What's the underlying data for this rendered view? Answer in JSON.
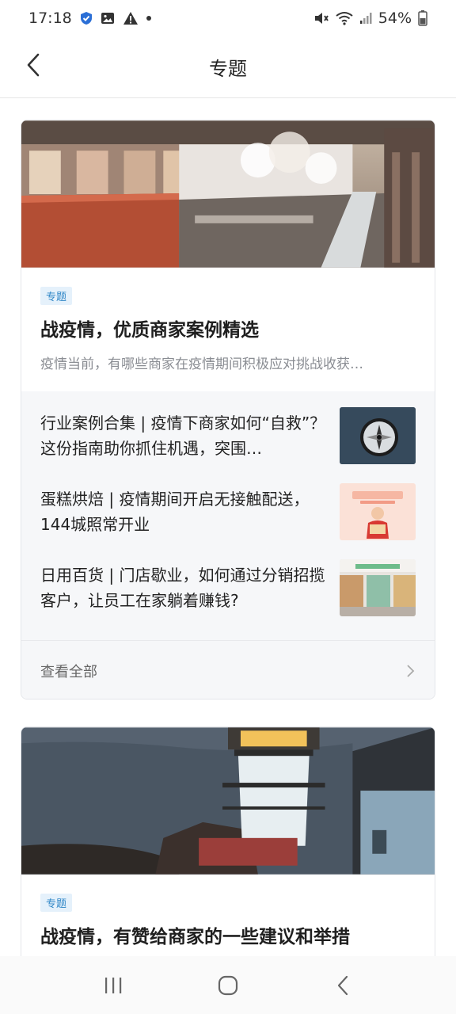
{
  "status_bar": {
    "time": "17:18",
    "battery": "54%"
  },
  "header": {
    "title": "专题"
  },
  "cards": [
    {
      "tag": "专题",
      "title": "战疫情，优质商家案例精选",
      "description": "疫情当前，有哪些商家在疫情期间积极应对挑战收获…",
      "articles": [
        {
          "title": "行业案例合集 | 疫情下商家如何“自救”？这份指南助你抓住机遇，突围…"
        },
        {
          "title": "蛋糕烘焙 | 疫情期间开启无接触配送，144城照常开业"
        },
        {
          "title": "日用百货 | 门店歇业，如何通过分销招揽客户，让员工在家躺着赚钱?"
        }
      ],
      "view_all": "查看全部"
    },
    {
      "tag": "专题",
      "title": "战疫情，有赞给商家的一些建议和举措"
    }
  ],
  "icons": {
    "back": "chevron-left-icon",
    "view_all_arrow": "chevron-right-icon",
    "nav_recent": "recent-apps-icon",
    "nav_home": "home-icon",
    "nav_back": "nav-back-icon"
  },
  "colors": {
    "tag_text": "#2f86c7",
    "tag_bg": "#e5f1fb",
    "list_bg": "#f6f7f9"
  }
}
